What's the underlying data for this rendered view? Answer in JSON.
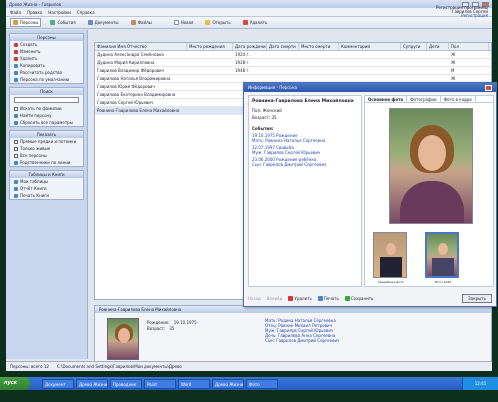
{
  "window": {
    "title": "Древо Жизни - Гаврилов"
  },
  "menu": [
    "Файл",
    "Правка",
    "Настройки",
    "Справка"
  ],
  "menu_right": {
    "line1": "Регистрация программы",
    "line2": "Гаврилов Сергей",
    "link": "Регистрация"
  },
  "toolbar": {
    "tabs": [
      "Персоны",
      "События",
      "Документы",
      "Файлы"
    ],
    "actions": [
      "Новая",
      "Открыть",
      "Удалить"
    ]
  },
  "left": {
    "persons_header": "Персоны",
    "persons_items": [
      "Создать",
      "Изменить",
      "Удалить",
      "Копировать",
      "Рассчитать родство",
      "Персона по умолчанию"
    ],
    "filter_header": "Поиск",
    "filter_items": [
      "Искать по фамилии",
      "Найти персону",
      "Сбросить все параметры"
    ],
    "view_header": "Показать",
    "view_items": [
      "Прямые предки и потомки",
      "Только живые",
      "Все персоны",
      "Родственники по линии"
    ],
    "tables_header": "Таблицы и Книги",
    "tables_items": [
      "Мои таблицы",
      "Отчёт Книги",
      "Печать Книги"
    ]
  },
  "grid": {
    "columns": [
      "Фамилия Имя Отчество",
      "Место рождения",
      "Дата рождения",
      "Дата смерти",
      "Место смерти",
      "Комментарий",
      "Супруги",
      "Дети",
      "Пол"
    ],
    "rows": [
      {
        "name": "Дудина Александра Семёновна",
        "date": "1924 г.",
        "sex": "Ж"
      },
      {
        "name": "Дудина Мария Кирилловна",
        "date": "1928 г.",
        "sex": "Ж"
      },
      {
        "name": "Гаврилов Владимир Фёдорович",
        "date": "1948 г.",
        "sex": "М"
      },
      {
        "name": "Гаврилова Наталья Владимировна",
        "date": "",
        "sex": "Ж"
      },
      {
        "name": "Гаврилов Юрий Фёдорович",
        "date": "",
        "sex": "М"
      },
      {
        "name": "Гаврилова Екатерина Владимировна",
        "date": "",
        "sex": "Ж"
      },
      {
        "name": "Гаврилов Сергей Юрьевич",
        "date": "",
        "sex": "М"
      },
      {
        "name": "Ровнина-Гаврилова Елена Михайловна",
        "date": "",
        "sex": "Ж"
      }
    ]
  },
  "bottom": {
    "header": "Ровнина-Гаврилова Елена Михайловна",
    "born_label": "Рождение:",
    "born_value": "19.10.1975",
    "age_label": "Возраст:",
    "age_value": "35",
    "relations": [
      "Мать: Родина Наталья Сергеевна",
      "Отец: Ровнин Михаил Петрович",
      "Муж: Гаврилов Сергей Юрьевич",
      "Дочь: Гаврилова Анна Сергеевна",
      "Сын: Гаврилов Дмитрий Сергеевич"
    ]
  },
  "dialog": {
    "title": "Информация - Персона",
    "person": "Ровнина-Гаврилова Елена Михайловна",
    "sex": "Пол: Женский",
    "age": "Возраст: 35",
    "events_header": "События:",
    "events": [
      "19.10.1975 Рождение",
      "Мать: Ровнина Наталья Сергеевна",
      "12.07.1997 Свадьба",
      "Муж: Гаврилов Сергей Юрьевич",
      "23.06.2000 Рождение ребёнка",
      "Сын: Гаврилов Дмитрий Сергеевич"
    ],
    "tabs": [
      "Основное фото",
      "Фотографии",
      "Фото в кадре"
    ],
    "thumb_labels": [
      "Свадебное фото",
      "Фото 2010"
    ],
    "footer": [
      "Назад",
      "Вперёд",
      "Удалить",
      "Печать",
      "Сохранить"
    ],
    "ok": "Закрыть"
  },
  "status": {
    "left": "Персоны: всего 12",
    "path": "C:\\Documents and Settings\\Гаврилов\\Мои документы\\Древо"
  },
  "taskbar": {
    "start": "пуск",
    "tasks": [
      "Документ",
      "Древо Жизни",
      "Проводник",
      "Paint",
      "Word",
      "Древо Жизни",
      "Фото"
    ],
    "clock": "12:45"
  }
}
